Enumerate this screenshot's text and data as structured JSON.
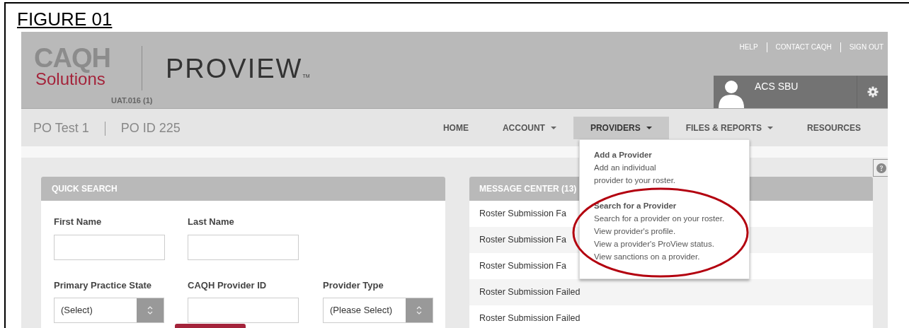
{
  "figure_title": "FIGURE 01",
  "header": {
    "logo_text": "CAQH",
    "logo_subtext": "Solutions",
    "product": "PROVIEW",
    "trademark": "TM",
    "environment": "UAT.016 (1)",
    "links": [
      "HELP",
      "CONTACT CAQH",
      "SIGN OUT"
    ],
    "user": "ACS SBU"
  },
  "org": {
    "name": "PO Test 1",
    "id": "PO ID 225"
  },
  "nav": [
    {
      "label": "HOME",
      "dropdown": false,
      "selected": false
    },
    {
      "label": "ACCOUNT",
      "dropdown": true,
      "selected": false
    },
    {
      "label": "PROVIDERS",
      "dropdown": true,
      "selected": true
    },
    {
      "label": "FILES & REPORTS",
      "dropdown": true,
      "selected": false
    },
    {
      "label": "RESOURCES",
      "dropdown": false,
      "selected": false
    }
  ],
  "dropdown": {
    "sections": [
      {
        "title": "Add a Provider",
        "lines": [
          "Add an individual",
          "provider to your roster."
        ],
        "highlighted": false
      },
      {
        "title": "Search for a Provider",
        "lines": [
          "Search for a provider on your roster.",
          "View provider's profile.",
          "View a provider's ProView status.",
          "View sanctions on a provider."
        ],
        "highlighted": true
      }
    ]
  },
  "quick_search": {
    "title": "QUICK SEARCH",
    "fields": [
      {
        "label": "First Name",
        "kind": "text"
      },
      {
        "label": "Last Name",
        "kind": "text"
      },
      {
        "label": "Primary Practice State",
        "kind": "select",
        "value": "(Select)"
      },
      {
        "label": "CAQH Provider ID",
        "kind": "text"
      },
      {
        "label": "Provider Type",
        "kind": "select",
        "value": "(Please Select)"
      }
    ]
  },
  "message_center": {
    "title": "MESSAGE CENTER (13)",
    "messages": [
      "Roster Submission Fa",
      "Roster Submission Fa",
      "Roster Submission Fa",
      "Roster Submission Failed",
      "Roster Submission Failed"
    ]
  }
}
